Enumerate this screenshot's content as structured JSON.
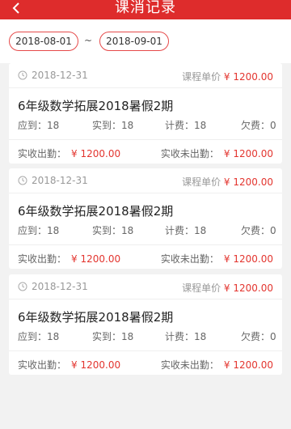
{
  "header": {
    "back_icon": "chevron-left-icon",
    "title": "课消记录"
  },
  "filter": {
    "start_date": "2018-08-01",
    "separator": "~",
    "end_date": "2018-09-01"
  },
  "records": [
    {
      "date": "2018-12-31",
      "unit_price_label": "课程单价",
      "unit_price": "¥ 1200.00",
      "course": "6年级数学拓展2018暑假2期",
      "due": "应到：18",
      "actual": "实到：18",
      "charged": "计费：18",
      "owed": "欠费：0",
      "paid_attended_label": "实收出勤：",
      "paid_attended": "¥ 1200.00",
      "paid_absent_label": "实收未出勤：",
      "paid_absent": "¥ 1200.00"
    },
    {
      "date": "2018-12-31",
      "unit_price_label": "课程单价",
      "unit_price": "¥ 1200.00",
      "course": "6年级数学拓展2018暑假2期",
      "due": "应到：18",
      "actual": "实到：18",
      "charged": "计费：18",
      "owed": "欠费：0",
      "paid_attended_label": "实收出勤：",
      "paid_attended": "¥ 1200.00",
      "paid_absent_label": "实收未出勤：",
      "paid_absent": "¥ 1200.00"
    },
    {
      "date": "2018-12-31",
      "unit_price_label": "课程单价",
      "unit_price": "¥ 1200.00",
      "course": "6年级数学拓展2018暑假2期",
      "due": "应到：18",
      "actual": "实到：18",
      "charged": "计费：18",
      "owed": "欠费：0",
      "paid_attended_label": "实收出勤：",
      "paid_attended": "¥ 1200.00",
      "paid_absent_label": "实收未出勤：",
      "paid_absent": "¥ 1200.00"
    }
  ],
  "colors": {
    "brand": "#de2c2c",
    "money": "#e3352f"
  }
}
